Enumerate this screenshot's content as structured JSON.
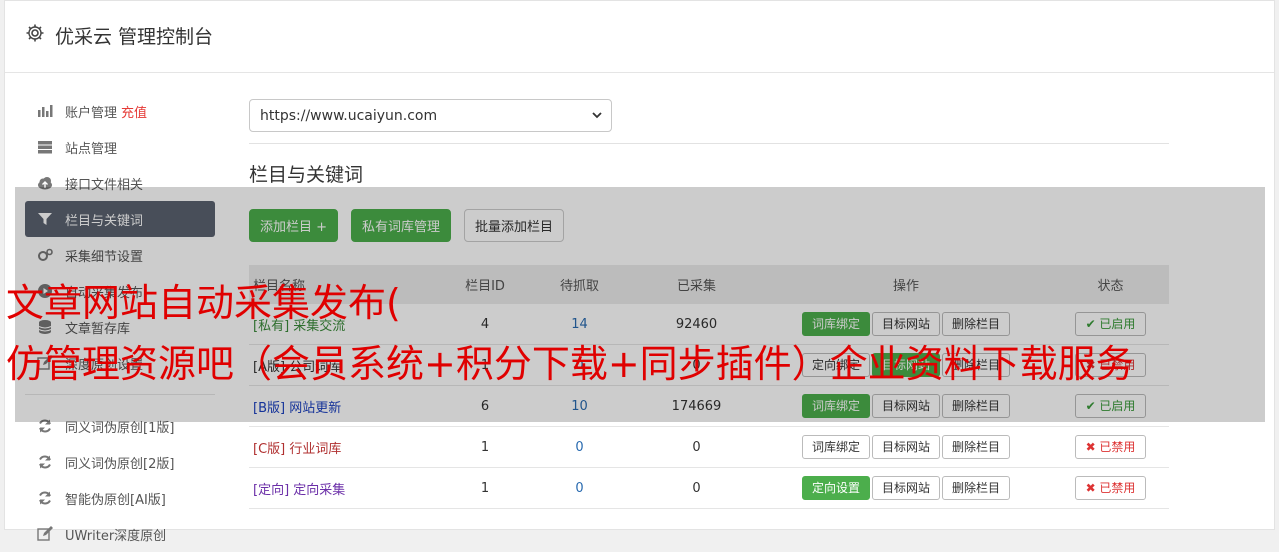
{
  "app": {
    "title": "优采云 管理控制台"
  },
  "sidebar": {
    "items": [
      {
        "label": "账户管理",
        "badge": "充值",
        "icon": "bar-chart-icon"
      },
      {
        "label": "站点管理",
        "icon": "server-icon"
      },
      {
        "label": "接口文件相关",
        "icon": "cloud-upload-icon"
      },
      {
        "label": "栏目与关键词",
        "icon": "filter-icon",
        "active": true
      },
      {
        "label": "采集细节设置",
        "icon": "cogs-icon"
      },
      {
        "label": "自动采集发布",
        "icon": "play-circle-icon"
      },
      {
        "label": "文章暂存库",
        "icon": "database-icon"
      },
      {
        "label": "深度原创设置",
        "icon": "edit-icon"
      }
    ],
    "items2": [
      {
        "label": "同义词伪原创[1版]",
        "icon": "refresh-icon"
      },
      {
        "label": "同义词伪原创[2版]",
        "icon": "refresh-icon"
      },
      {
        "label": "智能伪原创[AI版]",
        "icon": "refresh-icon"
      },
      {
        "label": "UWriter深度原创",
        "icon": "edit-icon"
      }
    ]
  },
  "main": {
    "site_select": "https://www.ucaiyun.com",
    "section_title": "栏目与关键词",
    "buttons": {
      "add": "添加栏目 +",
      "private_lib": "私有词库管理",
      "batch_add": "批量添加栏目"
    },
    "table": {
      "headers": [
        "栏目名称",
        "栏目ID",
        "待抓取",
        "已采集",
        "操作",
        "状态"
      ],
      "rows": [
        {
          "tag": "[私有]",
          "name": "采集交流",
          "id": "4",
          "pending": "14",
          "collected": "92460",
          "op1": "词库绑定",
          "op1_green": true,
          "op2": "目标网站",
          "op3": "删除栏目",
          "status": "✔ 已启用",
          "enabled": true,
          "cls": "c-private"
        },
        {
          "tag": "[A版]",
          "name": "公司词库",
          "id": "1",
          "pending": "0",
          "collected": "0",
          "op1": "定向绑定",
          "op1_green": false,
          "op2": "目标网站",
          "op2_green": true,
          "op3": "删除栏目",
          "status": "✖ 已禁用",
          "enabled": false,
          "cls": "c-a"
        },
        {
          "tag": "[B版]",
          "name": "网站更新",
          "id": "6",
          "pending": "10",
          "collected": "174669",
          "op1": "词库绑定",
          "op1_green": true,
          "op2": "目标网站",
          "op3": "删除栏目",
          "status": "✔ 已启用",
          "enabled": true,
          "cls": "c-b"
        },
        {
          "tag": "[C版]",
          "name": "行业词库",
          "id": "1",
          "pending": "0",
          "collected": "0",
          "op1": "词库绑定",
          "op1_green": false,
          "op2": "目标网站",
          "op3": "删除栏目",
          "status": "✖ 已禁用",
          "enabled": false,
          "cls": "c-c"
        },
        {
          "tag": "[定向]",
          "name": "定向采集",
          "id": "1",
          "pending": "0",
          "collected": "0",
          "op1": "定向设置",
          "op1_green": true,
          "op2": "目标网站",
          "op3": "删除栏目",
          "status": "✖ 已禁用",
          "enabled": false,
          "cls": "c-d"
        }
      ]
    }
  },
  "watermark": {
    "line1": "文章网站自动采集发布(",
    "line2": "仿管理资源吧（会员系统+积分下载+同步插件）企业资料下载服务"
  }
}
